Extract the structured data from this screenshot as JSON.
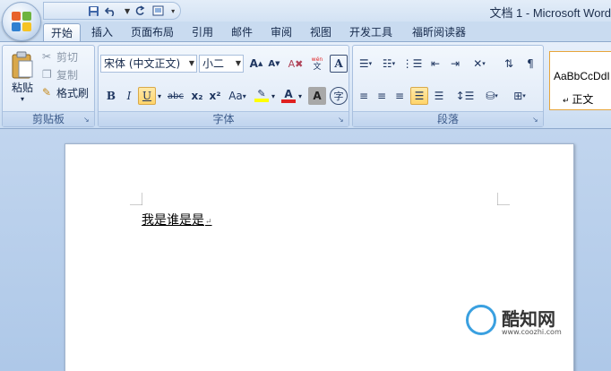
{
  "window": {
    "title": "文档 1 - Microsoft Word"
  },
  "quick_access": {
    "save_icon": "save-icon",
    "undo_icon": "undo-icon",
    "redo_icon": "redo-icon",
    "print_preview_icon": "print-preview-icon"
  },
  "tabs": [
    {
      "label": "开始",
      "active": true
    },
    {
      "label": "插入"
    },
    {
      "label": "页面布局"
    },
    {
      "label": "引用"
    },
    {
      "label": "邮件"
    },
    {
      "label": "审阅"
    },
    {
      "label": "视图"
    },
    {
      "label": "开发工具"
    },
    {
      "label": "福昕阅读器"
    }
  ],
  "clipboard": {
    "paste": "粘贴",
    "cut": "剪切",
    "copy": "复制",
    "format_painter": "格式刷",
    "group_label": "剪贴板"
  },
  "font": {
    "font_name": "宋体 (中文正文)",
    "font_size": "小二",
    "group_label": "字体",
    "bold": "B",
    "italic": "I",
    "underline": "U",
    "strikethrough": "abc",
    "subscript": "x₂",
    "superscript": "x²",
    "change_case": "Aa",
    "font_color": "A",
    "char_shading": "A",
    "phonetic_guide": "wén",
    "char_border": "A",
    "enclose_char": "字",
    "grow_font": "A",
    "shrink_font": "A",
    "active_color": "#ffd46a",
    "font_color_bar": "#e02020",
    "highlight_bar": "#ffff00"
  },
  "paragraph": {
    "group_label": "段落"
  },
  "styles": {
    "sample": "AaBbCcDdI",
    "name": "正文",
    "border_color": "#e7a53b"
  },
  "document": {
    "text": "我是谁是是",
    "paragraph_mark": "↵"
  },
  "watermark": {
    "name": "酷知网",
    "url": "www.coozhi.com"
  }
}
